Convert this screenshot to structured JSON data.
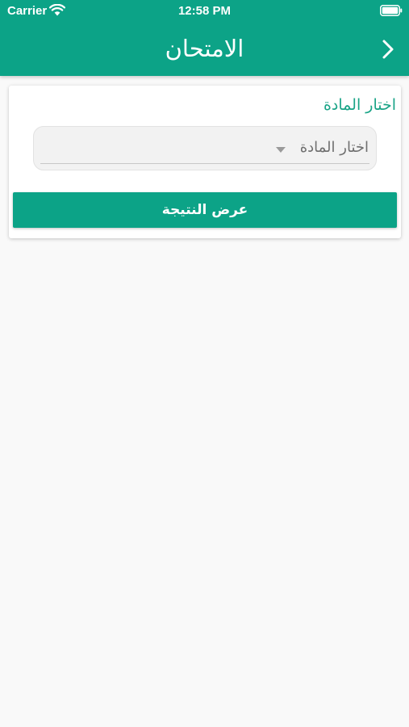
{
  "status_bar": {
    "carrier": "Carrier",
    "time": "12:58 PM",
    "wifi_icon": "wifi-icon",
    "battery_icon": "battery-icon"
  },
  "header": {
    "title": "الامتحان",
    "back_icon": "chevron-right-icon",
    "background_color": "#0ca387"
  },
  "form": {
    "subject_label": "اختار المادة",
    "subject_select": {
      "selected": "اختار المادة",
      "caret_icon": "caret-down-icon"
    },
    "submit_label": "عرض النتيجة"
  },
  "colors": {
    "accent": "#0ca387",
    "label_text": "#1aa487",
    "background": "#f9f9f9"
  }
}
